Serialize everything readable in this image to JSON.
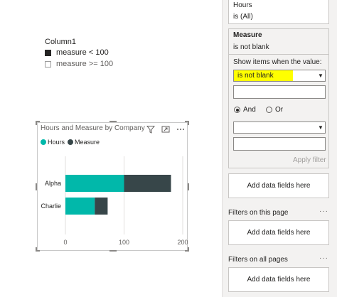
{
  "slicer": {
    "title": "Column1",
    "items": [
      {
        "label": "measure < 100",
        "checked": true
      },
      {
        "label": "measure >= 100",
        "checked": false
      }
    ]
  },
  "visual": {
    "title": "Hours and Measure by Company",
    "icons": [
      "filter-icon",
      "focus-mode-icon",
      "more-options-icon"
    ],
    "legend": [
      {
        "label": "Hours",
        "color": "#01b8aa"
      },
      {
        "label": "Measure",
        "color": "#374649"
      }
    ]
  },
  "chart_data": {
    "type": "bar",
    "orientation": "horizontal",
    "stacked": true,
    "title": "Hours and Measure by Company",
    "categories": [
      "Alpha",
      "Charlie"
    ],
    "series": [
      {
        "name": "Hours",
        "color": "#01b8aa",
        "values": [
          100,
          50
        ]
      },
      {
        "name": "Measure",
        "color": "#374649",
        "values": [
          80,
          22
        ]
      }
    ],
    "xlim": [
      0,
      200
    ],
    "x_ticks": [
      "0",
      "100",
      "200"
    ],
    "grid": true
  },
  "filters": {
    "hours_card": {
      "field": "Hours",
      "state": "is (All)"
    },
    "measure_card": {
      "field": "Measure",
      "state": "is not blank",
      "show_items_label": "Show items when the value:",
      "condition1": "is not blank",
      "value1": "",
      "and_label": "And",
      "or_label": "Or",
      "and_selected": true,
      "condition2": "",
      "value2": "",
      "apply_label": "Apply filter"
    },
    "add_data_label": "Add data fields here",
    "section_page": "Filters on this page",
    "section_all": "Filters on all pages",
    "more_glyph": "···"
  },
  "colors": {
    "highlight": "#ffff00",
    "hours": "#01b8aa",
    "measure": "#374649"
  }
}
